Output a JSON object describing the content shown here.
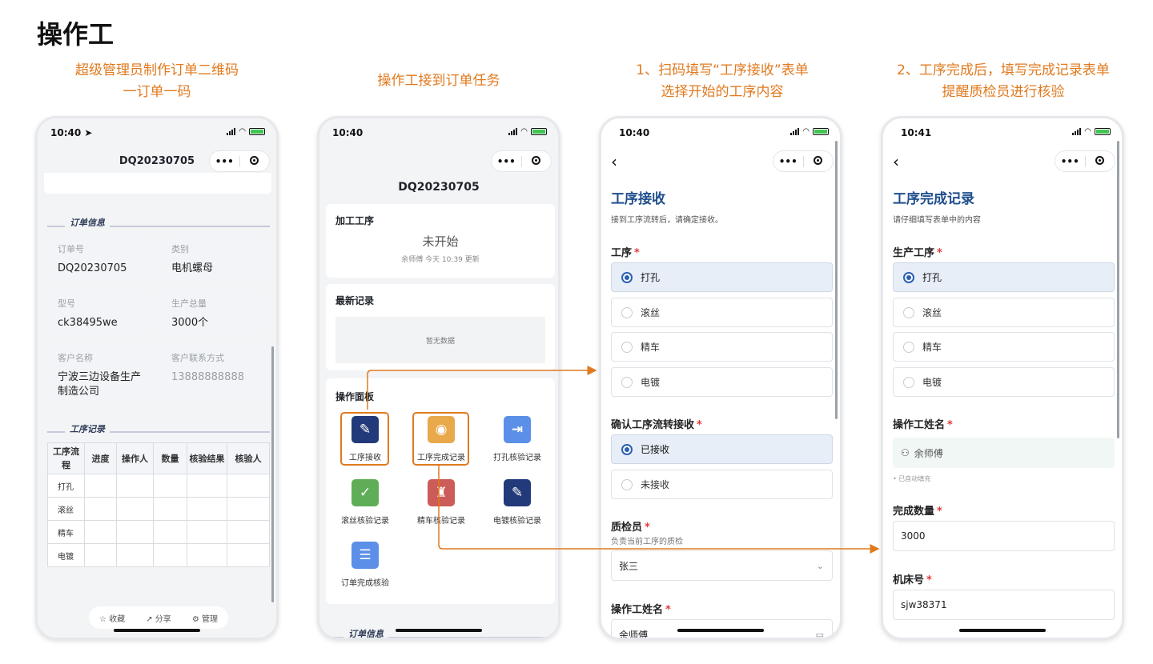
{
  "page": {
    "title": "操作工"
  },
  "captions": [
    {
      "line1": "超级管理员制作订单二维码",
      "line2": "一订单一码"
    },
    {
      "line1": "操作工接到订单任务",
      "line2": ""
    },
    {
      "line1": "1、扫码填写“工序接收”表单",
      "line2": "选择开始的工序内容"
    },
    {
      "line1": "2、工序完成后，填写完成记录表单",
      "line2": "提醒质检员进行核验"
    }
  ],
  "colors": {
    "accent": "#e07a1f",
    "title_blue": "#1f4e8c",
    "radio_blue": "#2a5fb4",
    "required": "#e03b3b"
  },
  "phone1": {
    "time": "10:40 ➤",
    "nav_title": "DQ20230705",
    "capsule": {
      "more": "•••"
    },
    "order_section": "订单信息",
    "fields": [
      {
        "label": "订单号",
        "value": "DQ20230705"
      },
      {
        "label": "类别",
        "value": "电机螺母"
      },
      {
        "label": "型号",
        "value": "ck38495we"
      },
      {
        "label": "生产总量",
        "value": "3000个"
      },
      {
        "label": "客户名称",
        "value": "宁波三边设备生产制造公司"
      },
      {
        "label": "客户联系方式",
        "value": "13888888888"
      }
    ],
    "records_section": "工序记录",
    "table": {
      "headers": [
        "工序流程",
        "进度",
        "操作人",
        "数量",
        "核验结果",
        "核验人"
      ],
      "rows": [
        "打孔",
        "滚丝",
        "精车",
        "电镀"
      ]
    },
    "bottom": {
      "collect": "收藏",
      "share": "分享",
      "manage": "管理"
    }
  },
  "phone2": {
    "time": "10:40",
    "order_no": "DQ20230705",
    "process_card": {
      "title": "加工工序",
      "status": "未开始",
      "meta": "余师傅 今天 10:39 更新"
    },
    "latest_card": {
      "title": "最新记录",
      "empty": "暂无数据"
    },
    "panel": {
      "title": "操作面板",
      "tiles": [
        {
          "label": "工序接收",
          "icon": "wrench-icon",
          "color": "#233a7a"
        },
        {
          "label": "工序完成记录",
          "icon": "location-pin-icon",
          "color": "#e8a94a"
        },
        {
          "label": "打孔核验记录",
          "icon": "inbox-arrow-icon",
          "color": "#5b8fe8"
        },
        {
          "label": "滚丝核验记录",
          "icon": "shield-check-icon",
          "color": "#5fae57"
        },
        {
          "label": "精车核验记录",
          "icon": "hydrant-icon",
          "color": "#cc5c57"
        },
        {
          "label": "电镀核验记录",
          "icon": "wrench-icon",
          "color": "#233a7a"
        },
        {
          "label": "订单完成核验",
          "icon": "list-icon",
          "color": "#5b8fe8"
        }
      ]
    },
    "order_section": "订单信息"
  },
  "phone3": {
    "time": "10:40",
    "back": "‹",
    "title": "工序接收",
    "subtitle": "接到工序流转后，请确定接收。",
    "process_label": "工序",
    "process_options": [
      "打孔",
      "滚丝",
      "精车",
      "电镀"
    ],
    "process_selected": "打孔",
    "confirm_label": "确认工序流转接收",
    "confirm_options": [
      "已接收",
      "未接收"
    ],
    "inspector_label": "质检员",
    "inspector_hint": "负责当前工序的质检",
    "inspector_value": "张三",
    "operator_label": "操作工姓名",
    "operator_value": "余师傅"
  },
  "phone4": {
    "time": "10:41",
    "back": "‹",
    "title": "工序完成记录",
    "subtitle": "请仔细填写表单中的内容",
    "process_label": "生产工序",
    "process_options": [
      "打孔",
      "滚丝",
      "精车",
      "电镀"
    ],
    "operator_label": "操作工姓名",
    "operator_value": "余师傅",
    "autofill_hint": "• 已自动填充",
    "qty_label": "完成数量",
    "qty_value": "3000",
    "machine_label": "机床号",
    "machine_value": "sjw38371"
  }
}
